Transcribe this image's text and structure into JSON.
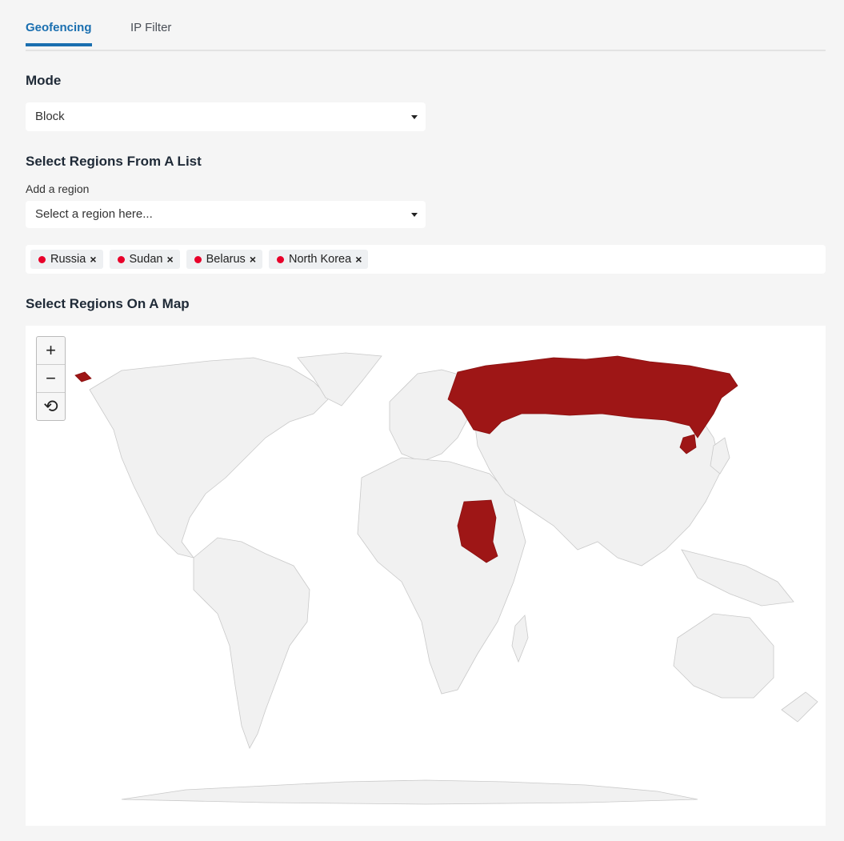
{
  "tabs": [
    {
      "label": "Geofencing",
      "active": true
    },
    {
      "label": "IP Filter",
      "active": false
    }
  ],
  "mode": {
    "title": "Mode",
    "value": "Block"
  },
  "list_section": {
    "title": "Select Regions From A List",
    "add_label": "Add a region",
    "placeholder": "Select a region here..."
  },
  "selected_regions": [
    {
      "name": "Russia"
    },
    {
      "name": "Sudan"
    },
    {
      "name": "Belarus"
    },
    {
      "name": "North Korea"
    }
  ],
  "map_section": {
    "title": "Select Regions On A Map"
  },
  "map_controls": {
    "zoom_in": "+",
    "zoom_out": "−",
    "reset": "⟲"
  },
  "colors": {
    "accent": "#1a6fb0",
    "selected_region": "#9e1616",
    "chip_dot": "#e8002a",
    "land": "#f1f1f1"
  },
  "icons": [
    "chevron-down-icon",
    "close-icon",
    "zoom-in-icon",
    "zoom-out-icon",
    "reset-icon"
  ]
}
